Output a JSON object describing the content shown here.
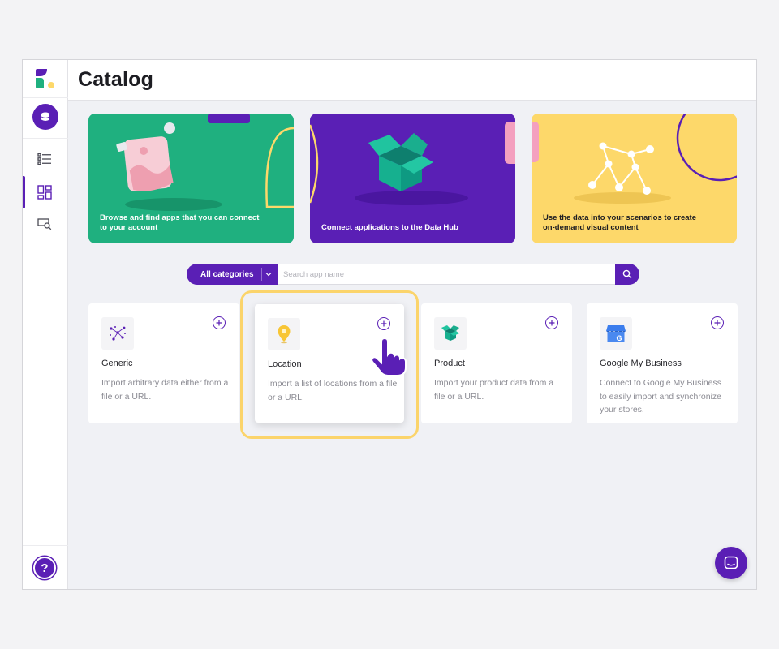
{
  "header": {
    "title": "Catalog"
  },
  "sidebar": {
    "items": [
      {
        "name": "database-icon"
      },
      {
        "name": "list-icon"
      },
      {
        "name": "catalog-icon",
        "active": true
      },
      {
        "name": "search-preview-icon"
      }
    ],
    "help_label": "?"
  },
  "banners": [
    {
      "text": "Browse and find apps that you can connect to your account",
      "bg": "#1fb07f",
      "text_color": "#ffffff"
    },
    {
      "text": "Connect applications to the Data Hub",
      "bg": "#5a1fb5",
      "text_color": "#ffffff"
    },
    {
      "text": "Use the data into your scenarios to create on-demand visual content",
      "bg": "#fdd86a",
      "text_color": "#1d1d22"
    }
  ],
  "search": {
    "category_label": "All categories",
    "placeholder": "Search app name",
    "value": ""
  },
  "cards": [
    {
      "title": "Generic",
      "description": "Import arbitrary data either from a file or a URL.",
      "icon": "scatter-dots-icon"
    },
    {
      "title": "Location",
      "description": "Import a list of locations from a file or a URL.",
      "icon": "map-pin-icon",
      "highlighted": true
    },
    {
      "title": "Product",
      "description": "Import your product data from a file or a URL.",
      "icon": "box-icon"
    },
    {
      "title": "Google My Business",
      "description": "Connect to Google My Business to easily import and synchronize your stores.",
      "icon": "google-my-business-icon"
    }
  ],
  "colors": {
    "accent": "#5a1fb5",
    "highlight": "#fbd46b",
    "green": "#1fb07f",
    "yellow": "#fdd86a"
  }
}
